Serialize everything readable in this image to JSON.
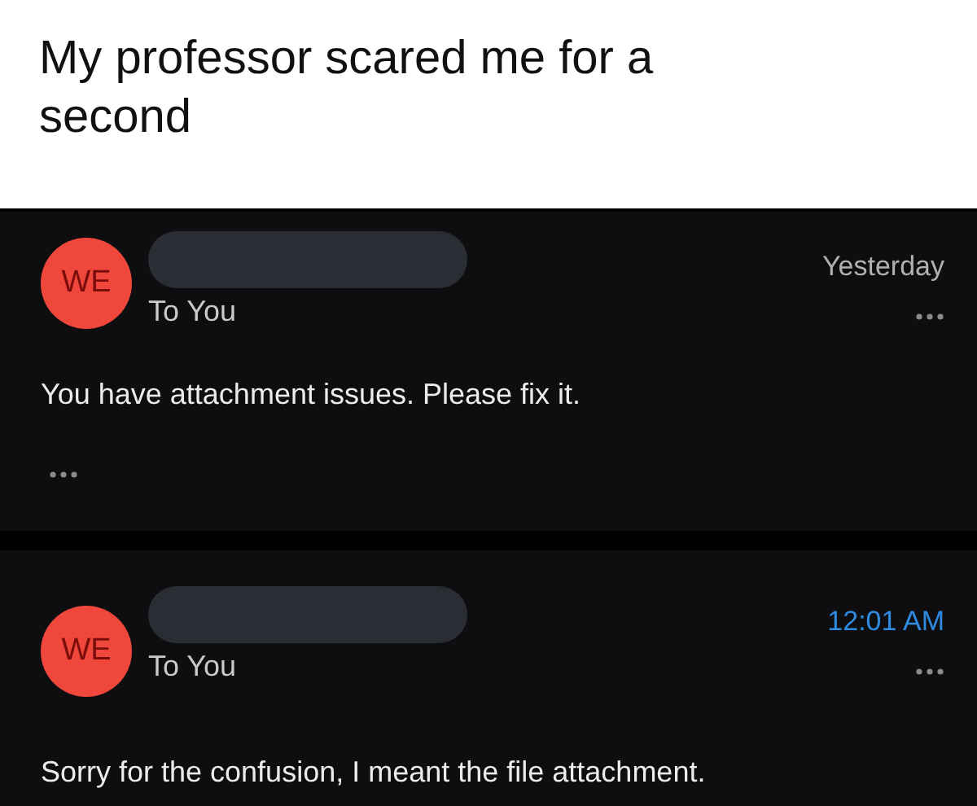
{
  "caption": "My professor scared me for a second",
  "messages": [
    {
      "avatar": "WE",
      "recipient": "To You",
      "time": "Yesterday",
      "unread": false,
      "body": "You have attachment issues. Please fix it.",
      "quoted_text_hidden": true
    },
    {
      "avatar": "WE",
      "recipient": "To You",
      "time": "12:01 AM",
      "unread": true,
      "body": "Sorry for the confusion, I meant the file attachment.",
      "quoted_text_hidden": false
    }
  ]
}
